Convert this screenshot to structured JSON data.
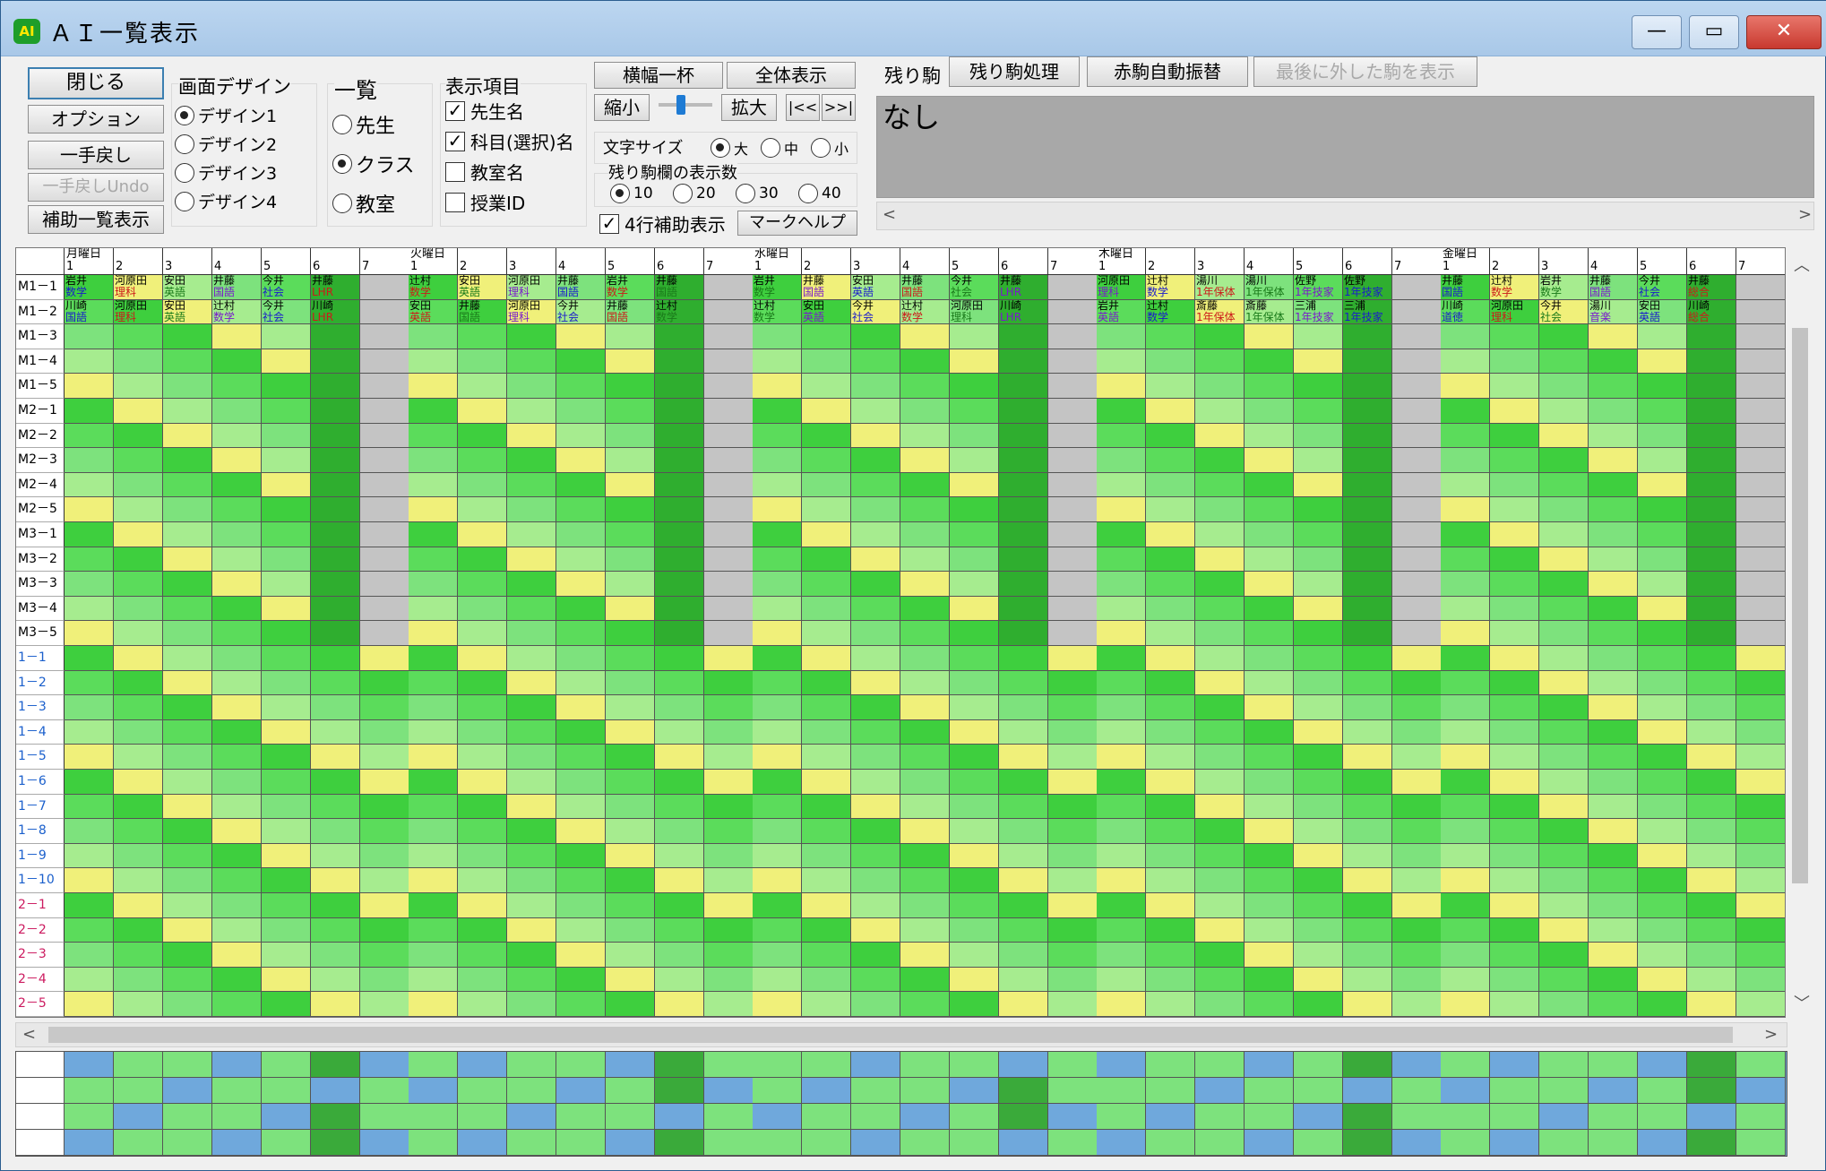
{
  "window": {
    "title": "ＡＩ一覧表示",
    "icon_label": "AI",
    "min_glyph": "—",
    "max_glyph": "▭",
    "close_glyph": "✕"
  },
  "buttons": {
    "close": "閉じる",
    "options": "オプション",
    "undo": "一手戻し",
    "undo_undo": "一手戻しUndo",
    "aux_list": "補助一覧表示",
    "full_width": "横幅一杯",
    "show_all": "全体表示",
    "shrink": "縮小",
    "expand": "拡大",
    "first": "|<<",
    "last": ">>|",
    "mark_help": "マークヘルプ",
    "remaining_process": "残り駒処理",
    "red_auto": "赤駒自動振替",
    "last_removed": "最後に外した駒を表示"
  },
  "design": {
    "title": "画面デザイン",
    "options": [
      "デザイン1",
      "デザイン2",
      "デザイン3",
      "デザイン4"
    ],
    "selected": 0
  },
  "list": {
    "title": "一覧",
    "options": [
      "先生",
      "クラス",
      "教室"
    ],
    "selected": 1
  },
  "display": {
    "title": "表示項目",
    "items": [
      {
        "label": "先生名",
        "checked": true
      },
      {
        "label": "科目(選択)名",
        "checked": true
      },
      {
        "label": "教室名",
        "checked": false
      },
      {
        "label": "授業ID",
        "checked": false
      }
    ]
  },
  "font_size": {
    "title": "文字サイズ",
    "options": [
      "大",
      "中",
      "小"
    ],
    "selected": 0
  },
  "remaining_count": {
    "title": "残り駒欄の表示数",
    "options": [
      "10",
      "20",
      "30",
      "40"
    ],
    "selected": 0
  },
  "four_row": {
    "label": "4行補助表示",
    "checked": true
  },
  "remaining": {
    "label": "残り駒",
    "content": "なし"
  },
  "grid": {
    "days": [
      "月曜日",
      "火曜日",
      "水曜日",
      "木曜日",
      "金曜日"
    ],
    "periods": [
      "1",
      "2",
      "3",
      "4",
      "5",
      "6",
      "7"
    ],
    "rows": [
      "M1－1",
      "M1－2",
      "M1－3",
      "M1－4",
      "M1－5",
      "M2－1",
      "M2－2",
      "M2－3",
      "M2－4",
      "M2－5",
      "M3－1",
      "M3－2",
      "M3－3",
      "M3－4",
      "M3－5",
      "1－1",
      "1－2",
      "1－3",
      "1－4",
      "1－5",
      "1－6",
      "1－7",
      "1－8",
      "1－9",
      "1－10",
      "2－1",
      "2－2",
      "2－3",
      "2－4",
      "2－5"
    ],
    "cells": [
      [
        "岩井",
        "数学",
        "河原田",
        "理科",
        "安田",
        "英語",
        "井藤",
        "国語",
        "今井",
        "社会",
        "井藤",
        "LHR",
        "",
        "",
        "辻村",
        "数学",
        "安田",
        "英語",
        "河原田",
        "理科",
        "井藤",
        "国語",
        "岩井",
        "数学",
        "井藤",
        "国語",
        "",
        "",
        "岩井",
        "数学",
        "井藤",
        "国語",
        "安田",
        "英語",
        "井藤",
        "国語",
        "今井",
        "社会",
        "井藤",
        "LHR",
        "",
        "",
        "河原田",
        "理科",
        "辻村",
        "数学",
        "湯川",
        "1年保体",
        "湯川",
        "1年保体",
        "佐野",
        "1年技家",
        "佐野",
        "1年技家",
        "",
        "",
        "井藤",
        "国語",
        "辻村",
        "数学",
        "岩井",
        "数学",
        "井藤",
        "国語",
        "今井",
        "社会",
        "井藤",
        "総合",
        "",
        ""
      ],
      [
        "川崎",
        "国語",
        "河原田",
        "理科",
        "安田",
        "英語",
        "辻村",
        "数学",
        "今井",
        "社会",
        "川崎",
        "LHR",
        "",
        "",
        "安田",
        "英語",
        "井藤",
        "国語",
        "河原田",
        "理科",
        "今井",
        "社会",
        "井藤",
        "国語",
        "辻村",
        "数学",
        "",
        "",
        "辻村",
        "数学",
        "安田",
        "英語",
        "今井",
        "社会",
        "辻村",
        "数学",
        "河原田",
        "理科",
        "川崎",
        "LHR",
        "",
        "",
        "岩井",
        "英語",
        "辻村",
        "数学",
        "斎藤",
        "1年保体",
        "斎藤",
        "1年保体",
        "三浦",
        "1年技家",
        "三浦",
        "1年技家",
        "",
        "",
        "川崎",
        "道徳",
        "河原田",
        "理科",
        "今井",
        "社会",
        "湯川",
        "音楽",
        "安田",
        "英語",
        "川崎",
        "総合",
        "",
        ""
      ]
    ]
  }
}
